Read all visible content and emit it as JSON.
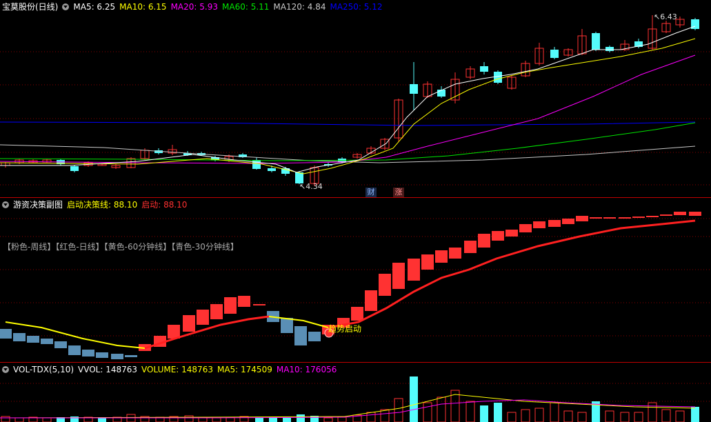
{
  "colors": {
    "up": "#ff3232",
    "down": "#54fcfc",
    "cap": "#5a8fb5",
    "ma5": "#ffffff",
    "ma10": "#ffff00",
    "ma20": "#ff00ff",
    "ma60": "#00e600",
    "ma120": "#c8c8c8",
    "ma250": "#0000ff",
    "grid": "#8b0000"
  },
  "main": {
    "title": "宝莫股份(日线)",
    "ma5": "MA5: 6.25",
    "ma10": "MA10: 6.15",
    "ma20": "MA20: 5.93",
    "ma60": "MA60: 5.11",
    "ma120": "MA120: 4.84",
    "ma250": "MA250: 5.12",
    "high_label": "6.43",
    "low_label": "4.34",
    "badge_cai": "财",
    "badge_zhang": "涨"
  },
  "sub": {
    "title": "游资决策副图",
    "line1": "启动决策线: 88.10",
    "line2": "启动: 88.10",
    "legend": "【粉色-周线】【红色-日线】【黄色-60分钟线】【青色-30分钟线】",
    "signal": "趋势启动"
  },
  "vol": {
    "title": "VOL-TDX(5,10)",
    "vvol": "VVOL: 148763",
    "volume": "VOLUME: 148763",
    "ma5": "MA5: 174509",
    "ma10": "MA10: 176056"
  }
}
